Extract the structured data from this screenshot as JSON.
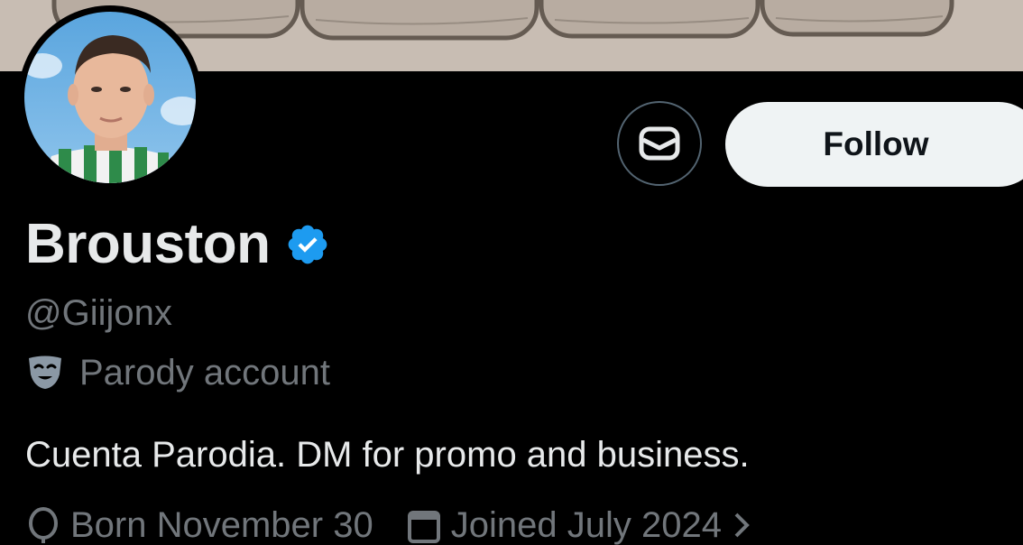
{
  "profile": {
    "display_name": "Brouston",
    "handle": "@Giijonx",
    "label": "Parody account",
    "bio": "Cuenta Parodia. DM for promo and business.",
    "born": "Born November 30",
    "joined": "Joined July 2024"
  },
  "actions": {
    "follow_label": "Follow"
  },
  "icons": {
    "verified": "verified-badge-icon",
    "parody": "theater-mask-icon",
    "dm": "envelope-icon",
    "born": "balloon-icon",
    "joined": "calendar-icon",
    "chevron": "chevron-right-icon"
  },
  "colors": {
    "background": "#000000",
    "primary_text": "#e7e9ea",
    "secondary_text": "#71767b",
    "verified": "#1d9bf0",
    "follow_bg": "#eff3f4"
  }
}
